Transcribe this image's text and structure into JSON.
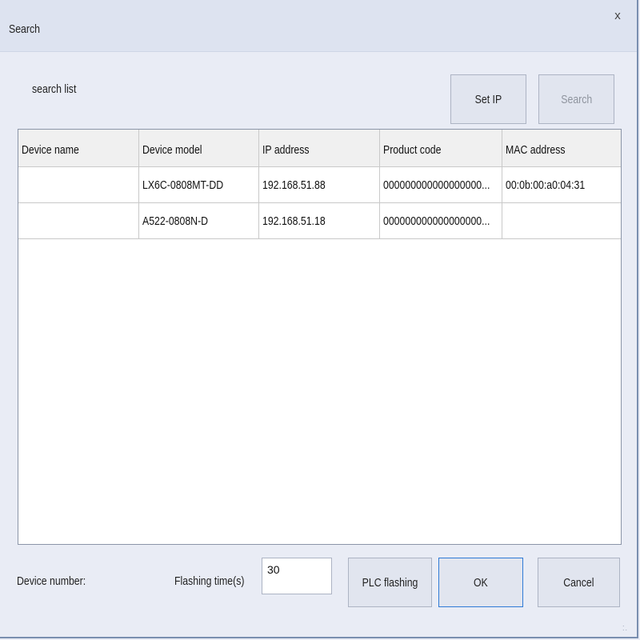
{
  "window": {
    "title": "Search",
    "close_label": "x"
  },
  "search_list_label": "search list",
  "buttons": {
    "set_ip": "Set IP",
    "search": "Search",
    "plc_flashing": "PLC flashing",
    "ok": "OK",
    "cancel": "Cancel"
  },
  "table": {
    "columns": [
      "Device name",
      "Device model",
      "IP address",
      "Product code",
      "MAC address"
    ],
    "rows": [
      [
        "",
        "LX6C-0808MT-DD",
        "192.168.51.88",
        "000000000000000000...",
        "00:0b:00:a0:04:31"
      ],
      [
        "",
        "A522-0808N-D",
        "192.168.51.18",
        "000000000000000000...",
        ""
      ]
    ]
  },
  "footer": {
    "device_number_label": "Device number:",
    "flashing_time_label": "Flashing time(s)",
    "flashing_time_value": "30"
  },
  "icons": {
    "resize_grip": "resize-grip-icon"
  }
}
